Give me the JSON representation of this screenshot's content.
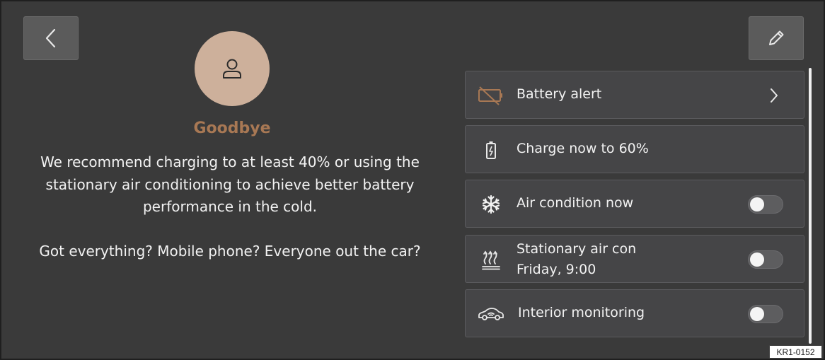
{
  "header": {
    "back_icon": "chevron-left-icon",
    "edit_icon": "pencil-icon"
  },
  "profile": {
    "avatar_icon": "person-icon",
    "greeting": "Goodbye",
    "message": "We recommend charging to at least 40% or using the stationary air conditioning to achieve better battery performance in the cold.",
    "checklist": "Got everything? Mobile phone? Everyone out the car?"
  },
  "tiles": [
    {
      "icon": "battery-crossed-icon",
      "label": "Battery alert",
      "action": "chevron-right-icon"
    },
    {
      "icon": "battery-charging-icon",
      "label": "Charge now to 60%"
    },
    {
      "icon": "snowflake-icon",
      "label": "Air condition now",
      "toggle_on": false
    },
    {
      "icon": "heat-waves-icon",
      "label": "Stationary air con",
      "sublabel": "Friday, 9:00",
      "toggle_on": false
    },
    {
      "icon": "car-monitor-icon",
      "label": "Interior monitoring",
      "toggle_on": false
    }
  ],
  "figure_code": "KR1-0152",
  "colors": {
    "background": "#3a3a3a",
    "tile": "#454547",
    "accent": "#a87854",
    "avatar": "#cdb09b"
  }
}
